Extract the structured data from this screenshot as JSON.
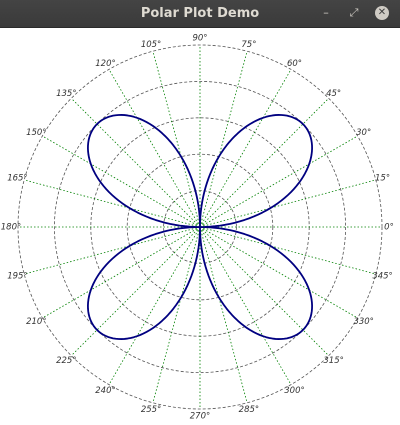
{
  "window": {
    "title": "Polar Plot Demo",
    "buttons": {
      "minimize_glyph": "–",
      "maximize_glyph": "⤢",
      "close_glyph": "✕"
    }
  },
  "chart_data": {
    "type": "polar-line",
    "curve": "r = |sin(2θ)| (four-petal rose)",
    "theta_deg_step": 1,
    "r_max": 1.25,
    "rings": [
      0.25,
      0.5,
      0.75,
      1.0,
      1.25
    ],
    "angle_labels": [
      "0°",
      "15°",
      "30°",
      "45°",
      "60°",
      "75°",
      "90°",
      "105°",
      "120°",
      "135°",
      "150°",
      "165°",
      "180°",
      "195°",
      "210°",
      "225°",
      "240°",
      "255°",
      "270°",
      "285°",
      "300°",
      "315°",
      "330°",
      "345°"
    ],
    "angles_deg": [
      0,
      15,
      30,
      45,
      60,
      75,
      90,
      105,
      120,
      135,
      150,
      165,
      180,
      195,
      210,
      225,
      240,
      255,
      270,
      285,
      300,
      315,
      330,
      345
    ],
    "grid": true,
    "colors": {
      "curve": "#000080",
      "rings": "#555555",
      "spokes": "#008000"
    }
  }
}
